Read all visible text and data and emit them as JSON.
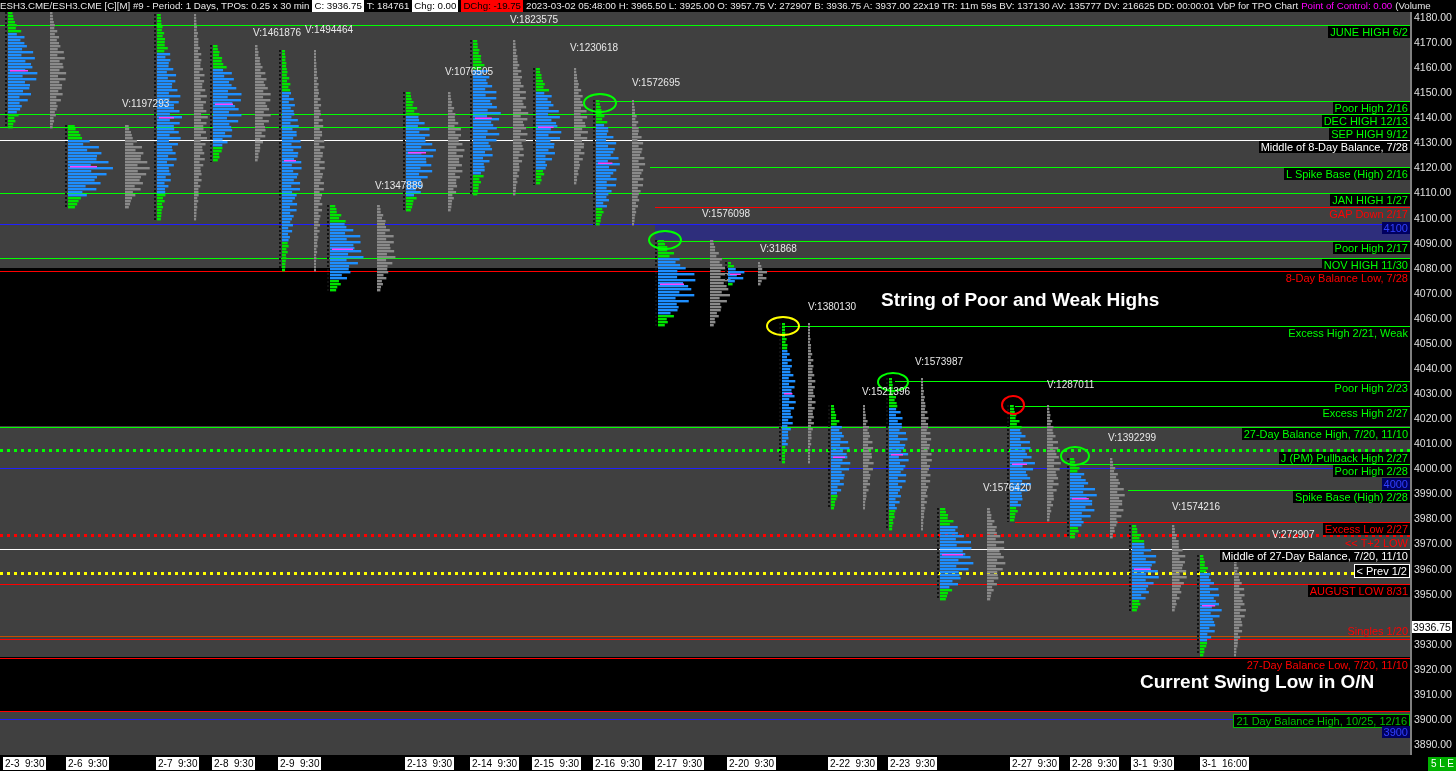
{
  "header": [
    {
      "text": "ESH3.CME/ESH3.CME [C][M]  #9 - Period: 1 Days, TPOs: 0.25 x 30 min",
      "kind": "plain"
    },
    {
      "text": "C: 3936.75",
      "kind": "white"
    },
    {
      "text": "T: 184761",
      "kind": "plain"
    },
    {
      "text": "Chg: 0.00",
      "kind": "white"
    },
    {
      "text": "DChg: -19.75",
      "kind": "red"
    },
    {
      "text": "2023-03-02 05:48:00 H: 3965.50 L: 3925.00 O: 3957.75 V: 272907 B: 3936.75 A: 3937.00 22x19 TR: 11m 59s BV: 137130 AV: 135777 DV: 216625 DD: 00:00:01 VbP for TPO Chart",
      "kind": "plain"
    },
    {
      "text": "Point of Control: 0.00",
      "kind": "magenta"
    },
    {
      "text": "(Volume",
      "kind": "plain"
    }
  ],
  "levels": [
    {
      "label": "JUNE HIGH 6/2",
      "color": "#00ff00",
      "boxed": true,
      "kind": "solid"
    },
    {
      "label": "Poor High 2/16",
      "color": "#00ff00",
      "boxed": true,
      "kind": "solid"
    },
    {
      "label": "DEC HIGH 12/13",
      "color": "#00ff00",
      "boxed": true,
      "kind": "solid"
    },
    {
      "label": "SEP HIGH 9/12",
      "color": "#00ff00",
      "boxed": true,
      "kind": "solid"
    },
    {
      "label": "Middle of 8-Day Balance, 7/28",
      "color": "#ffffff",
      "boxed": true,
      "kind": "solid"
    },
    {
      "label": "L Spike Base (High) 2/16",
      "color": "#00ff00",
      "boxed": true,
      "kind": "solid"
    },
    {
      "label": "JAN HIGH 1/27",
      "color": "#00ff00",
      "boxed": true,
      "kind": "solid"
    },
    {
      "label": "GAP Down 2/17",
      "color": "#ff0000",
      "boxed": false,
      "kind": "solid"
    },
    {
      "label": "Poor High 2/17",
      "color": "#00ff00",
      "boxed": true,
      "kind": "solid"
    },
    {
      "label": "NOV HIGH 11/30",
      "color": "#00ff00",
      "boxed": true,
      "kind": "solid"
    },
    {
      "label": "8-Day Balance Low, 7/28",
      "color": "#ff0000",
      "kind": "solid"
    },
    {
      "label": "Excess High 2/21, Weak",
      "color": "#00ff00",
      "kind": "solid"
    },
    {
      "label": "Poor High 2/23",
      "color": "#00ff00",
      "kind": "solid"
    },
    {
      "label": "Excess High 2/27",
      "color": "#00ff00",
      "kind": "solid"
    },
    {
      "label": "27-Day Balance High, 7/20, 11/10",
      "color": "#00ff00",
      "boxed": true,
      "kind": "solid"
    },
    {
      "label": "J (PM) Pullback High 2/27",
      "color": "#00ff00",
      "boxed": true,
      "kind": "dotted"
    },
    {
      "label": "Poor High 2/28",
      "color": "#00ff00",
      "boxed": true,
      "kind": "solid"
    },
    {
      "label": "Spike Base (High) 2/28",
      "color": "#00ff00",
      "boxed": true,
      "kind": "solid"
    },
    {
      "label": "Excess Low 2/27",
      "color": "#ff0000",
      "boxed": true,
      "kind": "solid"
    },
    {
      "label": "<< T+2 LOW",
      "color": "#ff0000",
      "boxed": false,
      "kind": "dotted"
    },
    {
      "label": "Middle of 27-Day Balance, 7/20, 11/10",
      "color": "#ffffff",
      "boxed": true,
      "kind": "solid"
    },
    {
      "label": "< Prev 1/2",
      "color": "#ffffff",
      "boxed": true,
      "kind": "none"
    },
    {
      "label": "AUGUST LOW 8/31",
      "color": "#ff0000",
      "boxed": true,
      "kind": "solid"
    },
    {
      "label": "Singles 1/20",
      "color": "#ff0000",
      "boxed": false,
      "kind": "solid"
    },
    {
      "label": "27-Day Balance Low, 7/20, 11/10",
      "color": "#ff0000",
      "kind": "solid"
    },
    {
      "label": "21 Day Balance High, 10/25, 12/16",
      "color": "#00c000",
      "boxed": true,
      "kind": "none"
    }
  ],
  "lines": [
    {
      "color": "#ffff00",
      "kind": "dotted"
    },
    {
      "color": "#c05000",
      "kind": "solid"
    },
    {
      "color": "#ff0000",
      "kind": "solid"
    }
  ],
  "round_numbers": [
    "4100",
    "4000",
    "3900"
  ],
  "volume_labels": [
    "V:1197293",
    "V:1461876",
    "V:1494464",
    "V:1823575",
    "V:1230618",
    "V:1076505",
    "V:1572695",
    "V:1347889",
    "V:1576098",
    "V:31868",
    "V:1380130",
    "V:1573987",
    "V:1521396",
    "V:1287011",
    "V:1392299",
    "V:1576420",
    "V:1574216",
    "V:272907"
  ],
  "markers": [
    {
      "color": "#00ff00"
    },
    {
      "color": "#00ff00"
    },
    {
      "color": "#ffff00"
    },
    {
      "color": "#00ff00"
    },
    {
      "color": "#ff0000"
    },
    {
      "color": "#00ff00"
    }
  ],
  "annotations": [
    "String of Poor and Weak Highs",
    "Current Swing Low in O/N"
  ],
  "price_axis": [
    "4180.00",
    "4170.00",
    "4160.00",
    "4150.00",
    "4140.00",
    "4130.00",
    "4120.00",
    "4110.00",
    "4100.00",
    "4090.00",
    "4080.00",
    "4070.00",
    "4060.00",
    "4050.00",
    "4040.00",
    "4030.00",
    "4020.00",
    "4010.00",
    "4000.00",
    "3990.00",
    "3980.00",
    "3970.00",
    "3960.00",
    "3950.00",
    "3930.00",
    "3920.00",
    "3910.00",
    "3900.00",
    "3890.00"
  ],
  "current_price": "3936.75",
  "time_axis": [
    "2-3  9:30",
    "2-6  9:30",
    "2-7  9:30",
    "2-8  9:30",
    "2-9  9:30",
    "2-13  9:30",
    "2-14  9:30",
    "2-15  9:30",
    "2-16  9:30",
    "2-17  9:30",
    "2-20  9:30",
    "2-22  9:30",
    "2-23  9:30",
    "2-27  9:30",
    "2-28  9:30",
    "3-1  9:30",
    "3-1  16:00"
  ],
  "status_badge": "5 L E"
}
